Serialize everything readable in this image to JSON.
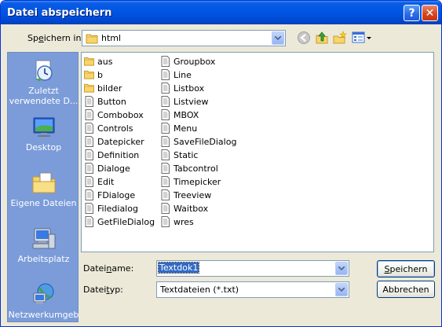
{
  "window": {
    "title": "Datei abspeichern",
    "help_glyph": "?",
    "close_glyph": "✕"
  },
  "lookin": {
    "label_pre": "Sp",
    "label_ul": "e",
    "label_post": "ichern in:",
    "value": "html"
  },
  "toolbar": {
    "icons": [
      "back-icon",
      "up-folder-icon",
      "new-folder-icon",
      "view-menu-icon"
    ]
  },
  "places": [
    {
      "label": "Zuletzt verwendete D...",
      "icon": "recent-documents-icon"
    },
    {
      "label": "Desktop",
      "icon": "desktop-icon"
    },
    {
      "label": "Eigene Dateien",
      "icon": "my-documents-icon"
    },
    {
      "label": "Arbeitsplatz",
      "icon": "my-computer-icon"
    },
    {
      "label": "Netzwerkumgeb",
      "icon": "network-icon"
    }
  ],
  "files": {
    "col1": [
      {
        "name": "aus",
        "type": "folder"
      },
      {
        "name": "b",
        "type": "folder"
      },
      {
        "name": "bilder",
        "type": "folder"
      },
      {
        "name": "Button",
        "type": "file"
      },
      {
        "name": "Combobox",
        "type": "file"
      },
      {
        "name": "Controls",
        "type": "file"
      },
      {
        "name": "Datepicker",
        "type": "file"
      },
      {
        "name": "Definition",
        "type": "file"
      },
      {
        "name": "Dialoge",
        "type": "file"
      },
      {
        "name": "Edit",
        "type": "file"
      },
      {
        "name": "FDialoge",
        "type": "file"
      },
      {
        "name": "Filedialog",
        "type": "file"
      },
      {
        "name": "GetFileDialog",
        "type": "file"
      }
    ],
    "col2": [
      {
        "name": "Groupbox",
        "type": "file"
      },
      {
        "name": "Line",
        "type": "file"
      },
      {
        "name": "Listbox",
        "type": "file"
      },
      {
        "name": "Listview",
        "type": "file"
      },
      {
        "name": "MBOX",
        "type": "file"
      },
      {
        "name": "Menu",
        "type": "file"
      },
      {
        "name": "SaveFileDialog",
        "type": "file"
      },
      {
        "name": "Static",
        "type": "file"
      },
      {
        "name": "Tabcontrol",
        "type": "file"
      },
      {
        "name": "Timepicker",
        "type": "file"
      },
      {
        "name": "Treeview",
        "type": "file"
      },
      {
        "name": "Waitbox",
        "type": "file"
      },
      {
        "name": "wres",
        "type": "file"
      }
    ]
  },
  "filename": {
    "label_pre": "Datei",
    "label_ul": "n",
    "label_post": "ame:",
    "value": "Textdok1"
  },
  "filetype": {
    "label_pre": "Datei",
    "label_ul": "t",
    "label_post": "yp:",
    "value": "Textdateien (*.txt)"
  },
  "buttons": {
    "save_ul": "S",
    "save_rest": "peichern",
    "cancel": "Abbrechen"
  },
  "colors": {
    "titlebar": "#0054e3",
    "dialog_bg": "#ece9d8",
    "places_bar": "#7b9cd9",
    "selection": "#316ac5"
  }
}
